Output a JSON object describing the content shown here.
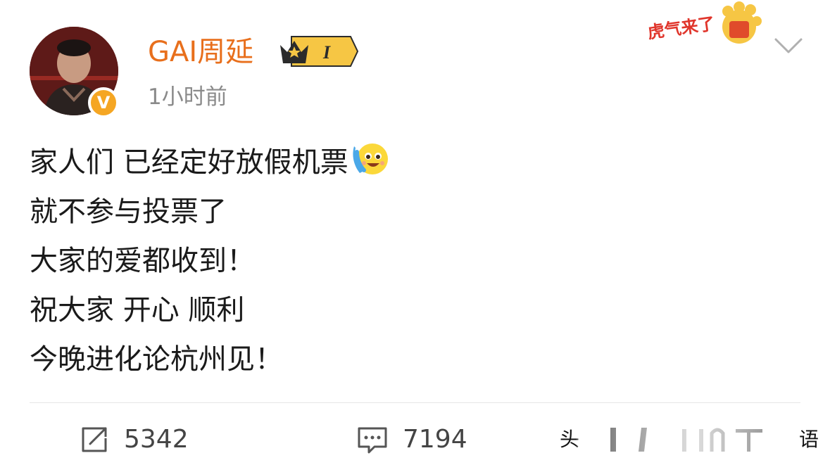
{
  "post": {
    "author": {
      "name": "GAI周延",
      "verified_badge": "V",
      "vip_level": "I",
      "avatar_icon": "avatar-icon"
    },
    "time": "1小时前",
    "sticker_text": "虎气来了",
    "lines": [
      "家人们 已经定好放假机票",
      "就不参与投票了",
      "大家的爱都收到！",
      "祝大家 开心 顺利",
      "今晚进化论杭州见！"
    ],
    "emoji_name": "tears-of-joy-emoji"
  },
  "actions": {
    "repost_count": "5342",
    "comment_count": "7194"
  },
  "watermark": {
    "left_char": "头",
    "right_char": "语"
  },
  "colors": {
    "username": "#e86f1c",
    "verified": "#f5a623",
    "timestamp": "#8a8a8a",
    "text": "#1a1a1a"
  }
}
